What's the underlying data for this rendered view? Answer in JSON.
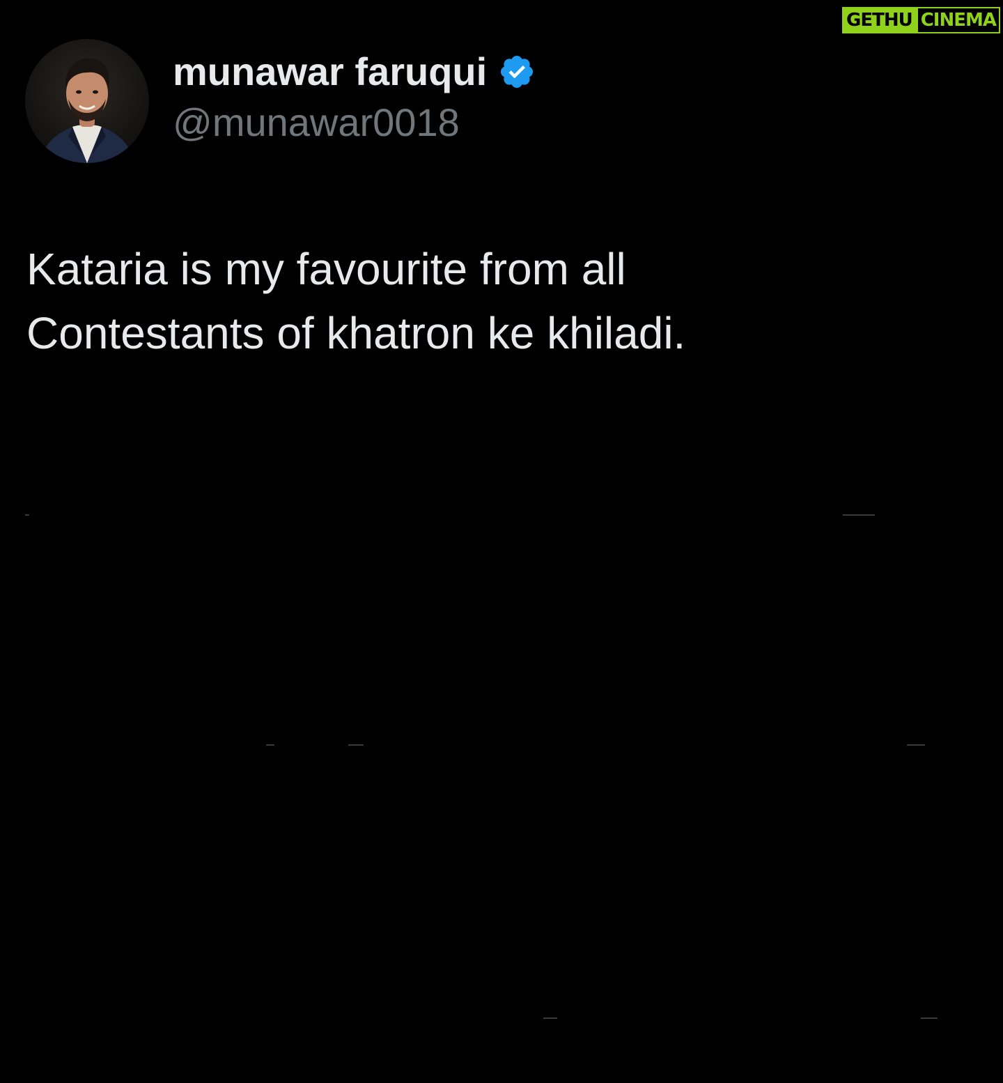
{
  "watermark": {
    "part1": "GETHU",
    "part2": "CINEMA",
    "color": "#8fd11b"
  },
  "tweet": {
    "author": {
      "display_name": "munawar faruqui",
      "handle": "@munawar0018",
      "verified": true,
      "verified_icon": "verified-badge-icon",
      "verified_color": "#1d9bf0"
    },
    "text_line1": "Kataria is my favourite from all",
    "text_line2": "Contestants of khatron ke khiladi."
  },
  "colors": {
    "background": "#000000",
    "primary_text": "#e7e9ea",
    "secondary_text": "#71767b"
  }
}
